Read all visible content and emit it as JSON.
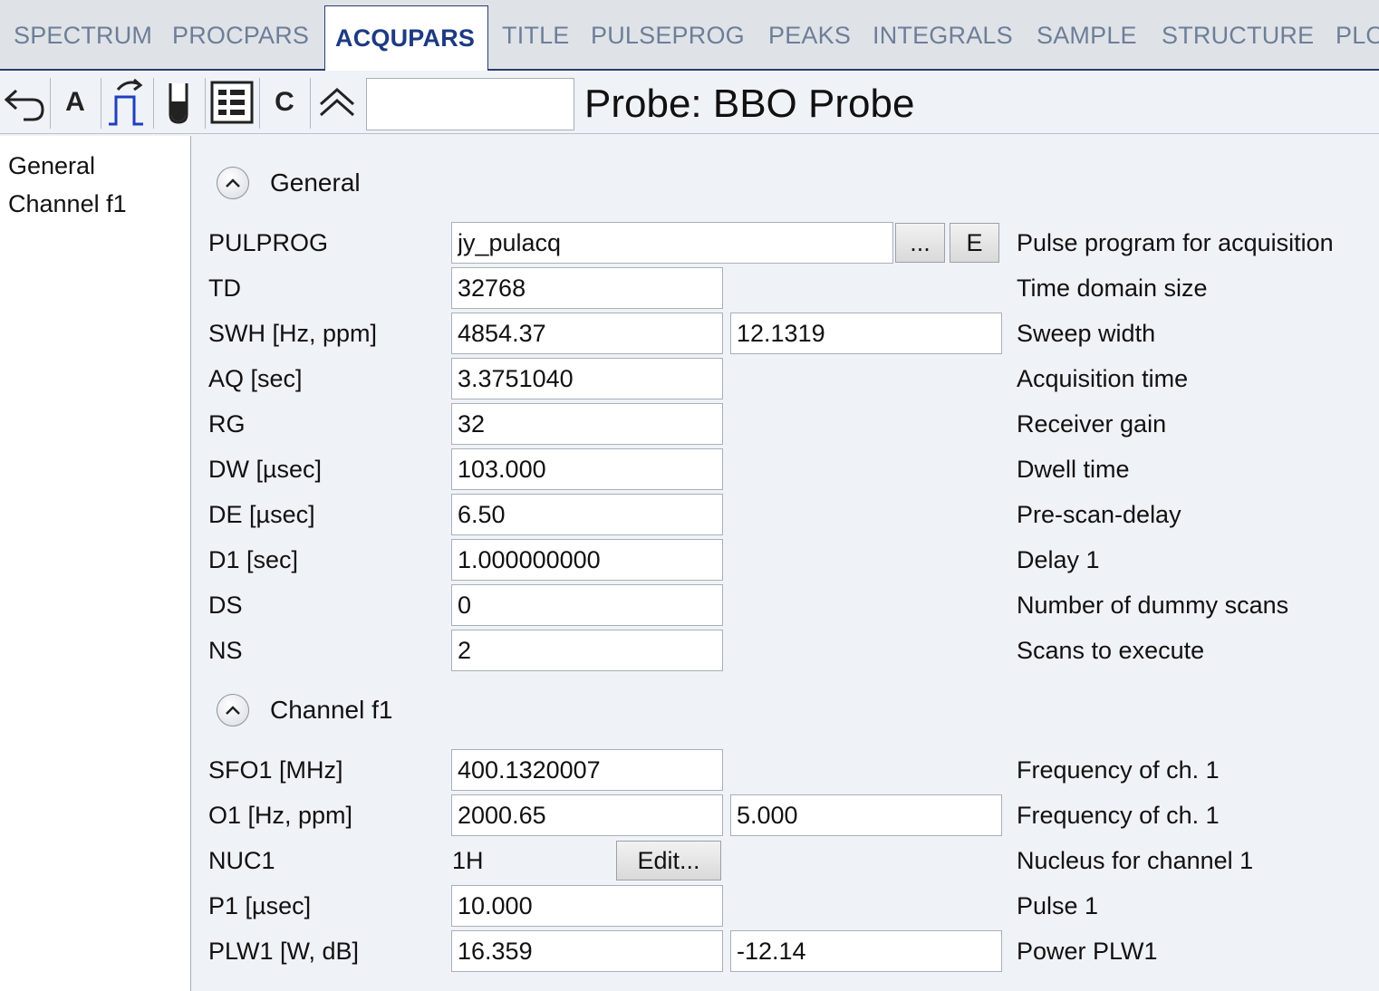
{
  "tabs": [
    {
      "label": "SPECTRUM"
    },
    {
      "label": "PROCPARS"
    },
    {
      "label": "ACQUPARS"
    },
    {
      "label": "TITLE"
    },
    {
      "label": "PULSEPROG"
    },
    {
      "label": "PEAKS"
    },
    {
      "label": "INTEGRALS"
    },
    {
      "label": "SAMPLE"
    },
    {
      "label": "STRUCTURE"
    },
    {
      "label": "PLO"
    }
  ],
  "active_tab": "ACQUPARS",
  "toolbar": {
    "a_label": "A",
    "c_label": "C",
    "search_value": "",
    "probe_title": "Probe: BBO Probe",
    "icons": [
      "undo-icon",
      "pulse-program-icon",
      "sample-tube-icon",
      "parameter-grid-icon",
      "collapse-all-icon"
    ]
  },
  "nav": {
    "items": [
      {
        "label": "General"
      },
      {
        "label": "Channel f1"
      }
    ]
  },
  "sections": {
    "general": {
      "title": "General",
      "pulprog": {
        "label": "PULPROG",
        "value": "jy_pulacq",
        "browse_label": "...",
        "edit_label": "E",
        "desc": "Pulse program for acquisition"
      },
      "td": {
        "label": "TD",
        "value": "32768",
        "desc": "Time domain size"
      },
      "swh": {
        "label": "SWH [Hz, ppm]",
        "value": "4854.37",
        "value2": "12.1319",
        "desc": "Sweep width"
      },
      "aq": {
        "label": "AQ [sec]",
        "value": "3.3751040",
        "desc": "Acquisition time"
      },
      "rg": {
        "label": "RG",
        "value": "32",
        "desc": "Receiver gain"
      },
      "dw": {
        "label": "DW [µsec]",
        "value": "103.000",
        "desc": "Dwell time"
      },
      "de": {
        "label": "DE [µsec]",
        "value": "6.50",
        "desc": "Pre-scan-delay"
      },
      "d1": {
        "label": "D1 [sec]",
        "value": "1.000000000",
        "desc": "Delay 1"
      },
      "ds": {
        "label": "DS",
        "value": "0",
        "desc": "Number of dummy scans"
      },
      "ns": {
        "label": "NS",
        "value": "2",
        "desc": "Scans to execute"
      }
    },
    "channel_f1": {
      "title": "Channel f1",
      "sfo1": {
        "label": "SFO1 [MHz]",
        "value": "400.1320007",
        "desc": "Frequency of ch. 1"
      },
      "o1": {
        "label": "O1 [Hz, ppm]",
        "value": "2000.65",
        "value2": "5.000",
        "desc": "Frequency of ch. 1"
      },
      "nuc1": {
        "label": "NUC1",
        "value": "1H",
        "edit_label": "Edit...",
        "desc": "Nucleus for channel 1"
      },
      "p1": {
        "label": "P1 [µsec]",
        "value": "10.000",
        "desc": "Pulse 1"
      },
      "plw1": {
        "label": "PLW1 [W, dB]",
        "value": "16.359",
        "value2": "-12.14",
        "desc": "Power PLW1"
      }
    }
  },
  "colors": {
    "active_tab_text": "#1d3a82",
    "inactive_tab_text": "#6d7e98",
    "tabbar_bg": "#dfe3e8",
    "panel_bg": "#eff2f6"
  }
}
